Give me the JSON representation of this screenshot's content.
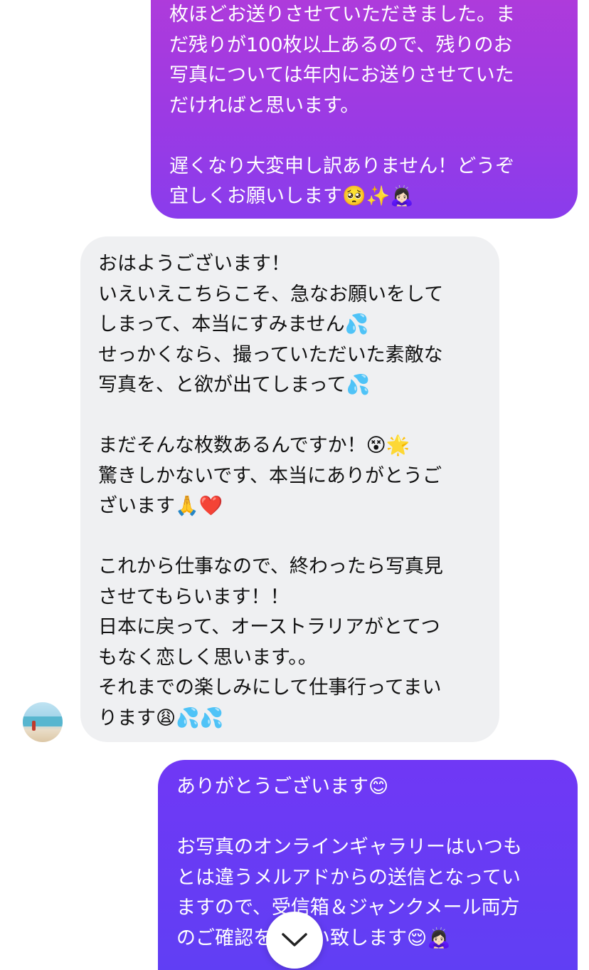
{
  "messages": {
    "outgoing_1": {
      "lines": [
        "枚ほどお送りさせていただきました。ま",
        "だ残りが100枚以上あるので、残りのお",
        "写真については年内にお送りさせていた",
        "だければと思います。",
        "",
        "遅くなり大変申し訳ありません！どうぞ",
        "宜しくお願いします🥺✨🙇🏻‍♀️"
      ]
    },
    "incoming_1": {
      "lines": [
        "おはようございます！",
        "いえいえこちらこそ、急なお願いをして",
        "しまって、本当にすみません💦",
        "せっかくなら、撮っていただいた素敵な",
        "写真を、と欲が出てしまって💦",
        "",
        "まだそんな枚数あるんですか！😵🌟",
        "驚きしかないです、本当にありがとうご",
        "ざいます🙏❤️",
        "",
        "これから仕事なので、終わったら写真見",
        "させてもらいます！！",
        "日本に戻って、オーストラリアがとてつ",
        "もなく恋しく思います。。",
        "それまでの楽しみにして仕事行ってまい",
        "ります😩💦💦"
      ]
    },
    "outgoing_2": {
      "lines": [
        "ありがとうございます😊",
        "",
        "お写真のオンラインギャラリーはいつも",
        "とは違うメルアドからの送信となってい",
        "ますので、受信箱＆ジャンクメール両方",
        "のご確認をお願い致します😌🙇🏻‍♀️"
      ]
    }
  },
  "icons": {
    "scroll_down": "chevron-down-icon",
    "avatar": "avatar"
  },
  "colors": {
    "outgoing_1_top": "#b23bd9",
    "outgoing_1_bottom": "#8a3cec",
    "outgoing_2": "#6a3af5",
    "incoming": "#eff0f2"
  }
}
